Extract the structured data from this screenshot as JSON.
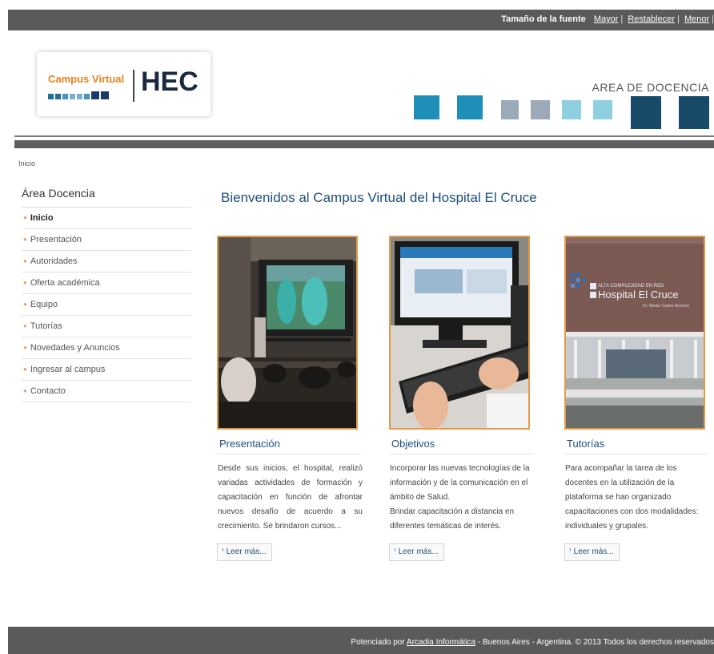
{
  "top_bar": {
    "font_size_label": "Tamaño de la fuente",
    "larger_link": "Mayor",
    "reset_link": "Restablecer",
    "smaller_link": "Menor"
  },
  "header": {
    "logo_campus_text": "Campus Virtual",
    "logo_hec_text": "HEC",
    "area_title": "AREA DE DOCENCIA",
    "brand_colors": {
      "orange": "#e8821d",
      "teal": "#1e8fb8",
      "navy": "#1a4a6a",
      "gray_blue": "#9aaab8",
      "light_teal": "#8fd0e0"
    }
  },
  "breadcrumb": {
    "current": "Inicio"
  },
  "sidebar": {
    "title": "Área Docencia",
    "items": [
      {
        "label": "Inicio",
        "active": true
      },
      {
        "label": "Presentación"
      },
      {
        "label": "Autoridades"
      },
      {
        "label": "Oferta académica"
      },
      {
        "label": "Equipo"
      },
      {
        "label": "Tutorías"
      },
      {
        "label": "Novedades y Anuncios"
      },
      {
        "label": "Ingresar al campus"
      },
      {
        "label": "Contacto"
      }
    ]
  },
  "main": {
    "welcome_title": "Bienvenidos al Campus Virtual del Hospital El Cruce",
    "cards": [
      {
        "title": "Presentación",
        "text": "Desde sus inicios, el hospital, realizó variadas actividades de formación y capacitación en función de afrontar nuevos desafío de acuerdo a su crecimiento. Se brindaron cursos...",
        "more": "Leer más..."
      },
      {
        "title": "Objetivos",
        "text": "Incorporar las nuevas tecnologías de la información y de la comunicación en el ámbito de Salud.",
        "text2": "Brindar capacitación a distancia en diferentes temáticas de interés.",
        "more": "Leer más..."
      },
      {
        "title": "Tutorías",
        "text": "Para acompañar la tarea de los docentes en la utilización de la plataforma se han organizado capacitaciones con dos modalidades: individuales y grupales.",
        "more": "Leer más...",
        "photo_sign_line1": "ALTA COMPLEJIDAD EN RED",
        "photo_sign_line2": "Hospital El Cruce",
        "photo_sign_line3": "Dr. Néstor Carlos Kirchner"
      }
    ]
  },
  "footer": {
    "prefix": "Potenciado por",
    "link": "Arcadia Informática",
    "suffix": "- Buenos Aires - Argentina. © 2013 Todos los derechos reservados"
  }
}
